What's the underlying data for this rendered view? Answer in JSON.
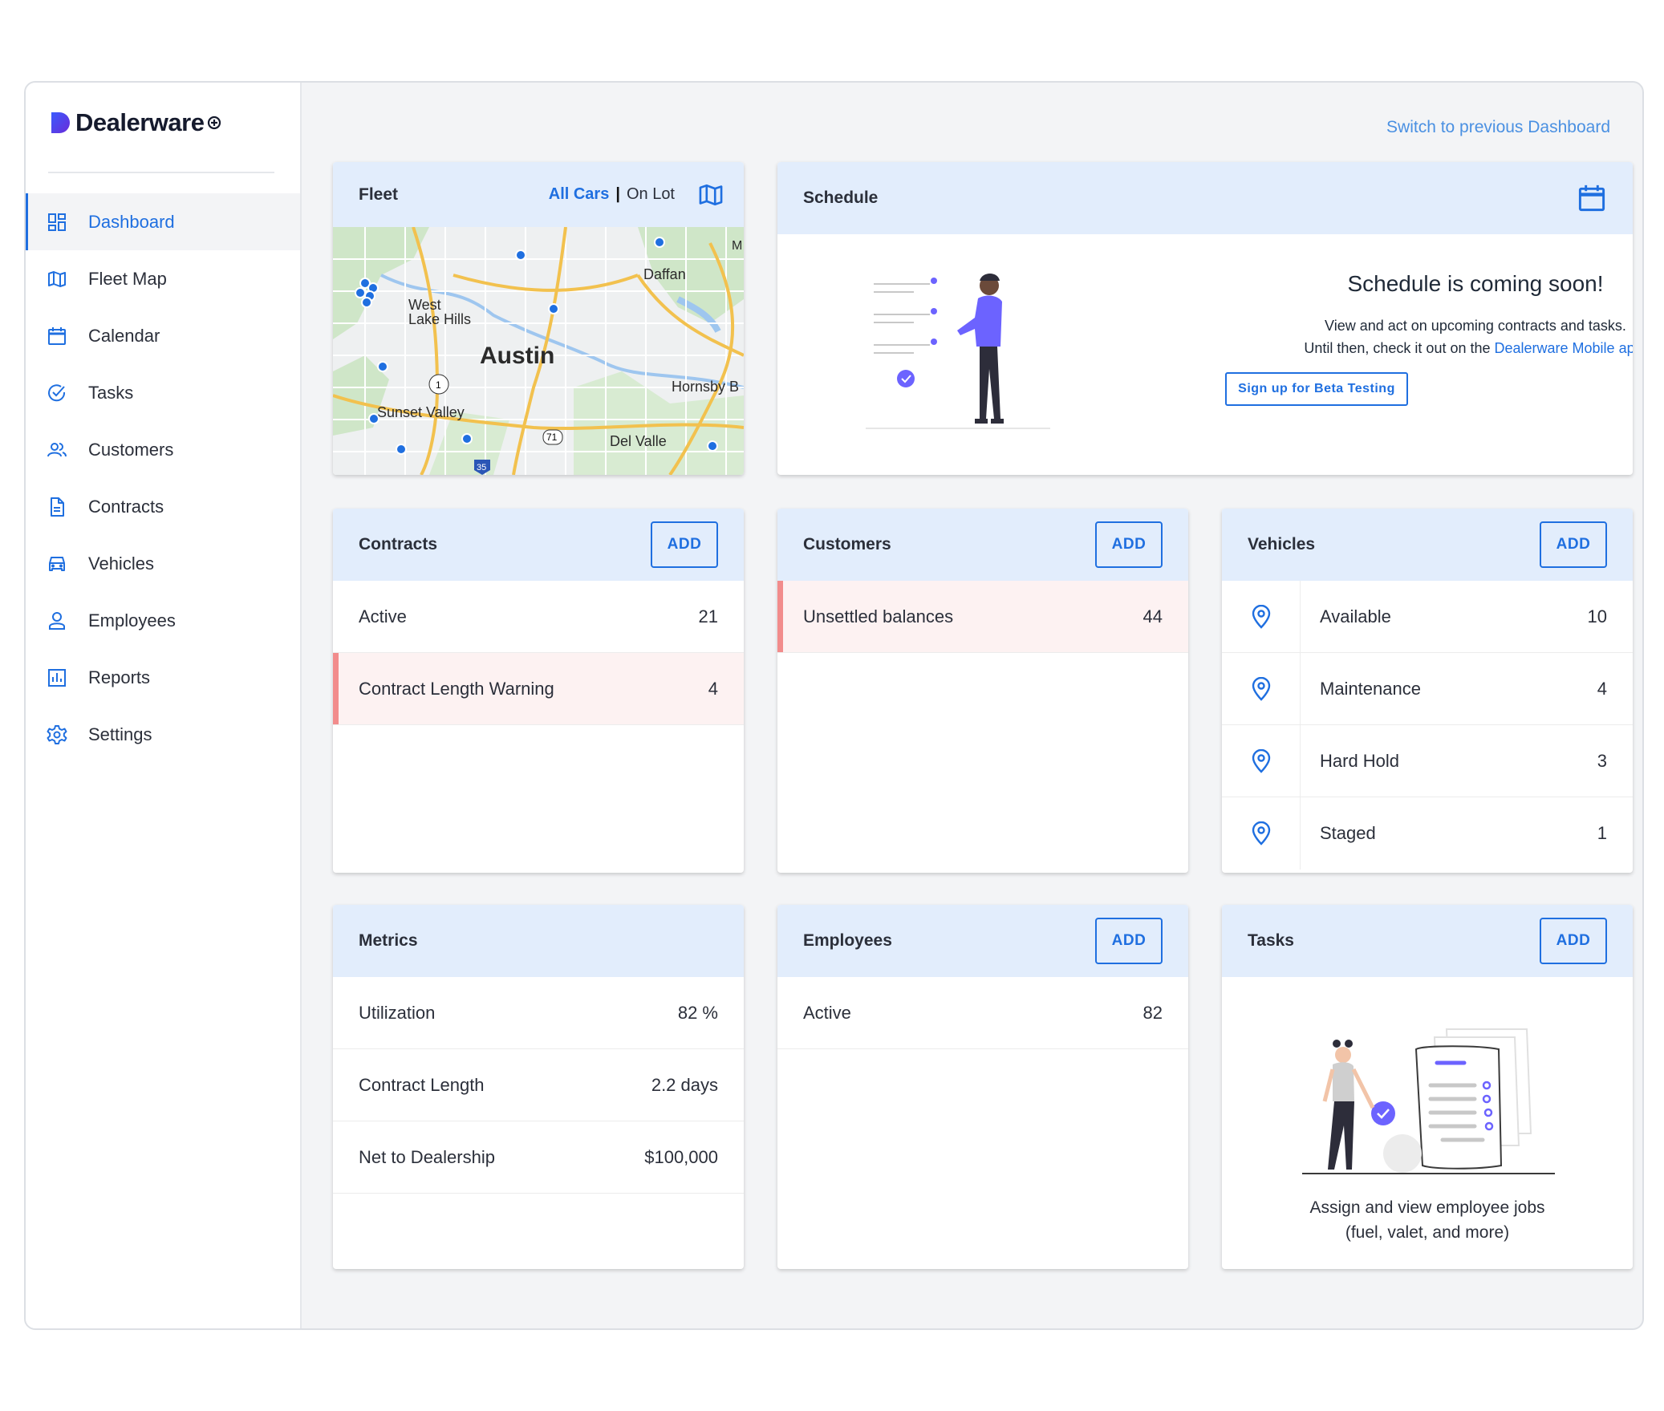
{
  "brand": {
    "name": "Dealerware",
    "accent": "#1f6fe0"
  },
  "sidebar": {
    "items": [
      {
        "label": "Dashboard",
        "icon": "dashboard-icon",
        "active": true
      },
      {
        "label": "Fleet Map",
        "icon": "map-icon"
      },
      {
        "label": "Calendar",
        "icon": "calendar-icon"
      },
      {
        "label": "Tasks",
        "icon": "check-circle-icon"
      },
      {
        "label": "Customers",
        "icon": "users-icon"
      },
      {
        "label": "Contracts",
        "icon": "document-icon"
      },
      {
        "label": "Vehicles",
        "icon": "car-icon"
      },
      {
        "label": "Employees",
        "icon": "user-icon"
      },
      {
        "label": "Reports",
        "icon": "bar-chart-icon"
      },
      {
        "label": "Settings",
        "icon": "gear-icon"
      }
    ]
  },
  "switch_link": "Switch to previous Dashboard",
  "fleet": {
    "title": "Fleet",
    "all_cars": "All Cars",
    "separator": "|",
    "on_lot": "On Lot",
    "map_labels": [
      "Austin",
      "West Lake Hills",
      "Daffan",
      "Hornsby B",
      "Sunset Valley",
      "Del Valle",
      "M",
      "1",
      "71",
      "35"
    ]
  },
  "schedule": {
    "title": "Schedule",
    "heading": "Schedule is coming soon!",
    "line1": "View and act on upcoming contracts and tasks.",
    "line2_prefix": "Until then, check it out on the ",
    "line2_link": "Dealerware Mobile app",
    "line2_suffix": ".",
    "beta_button": "Sign up for Beta Testing"
  },
  "contracts": {
    "title": "Contracts",
    "add": "ADD",
    "rows": [
      {
        "label": "Active",
        "value": "21",
        "warn": false
      },
      {
        "label": "Contract Length Warning",
        "value": "4",
        "warn": true
      }
    ]
  },
  "customers": {
    "title": "Customers",
    "add": "ADD",
    "rows": [
      {
        "label": "Unsettled balances",
        "value": "44",
        "warn": true
      }
    ]
  },
  "vehicles": {
    "title": "Vehicles",
    "add": "ADD",
    "rows": [
      {
        "label": "Available",
        "value": "10"
      },
      {
        "label": "Maintenance",
        "value": "4"
      },
      {
        "label": "Hard Hold",
        "value": "3"
      },
      {
        "label": "Staged",
        "value": "1"
      }
    ]
  },
  "metrics": {
    "title": "Metrics",
    "rows": [
      {
        "label": "Utilization",
        "value": "82 %"
      },
      {
        "label": "Contract Length",
        "value": "2.2 days"
      },
      {
        "label": "Net to Dealership",
        "value": "$100,000"
      }
    ]
  },
  "employees": {
    "title": "Employees",
    "add": "ADD",
    "rows": [
      {
        "label": "Active",
        "value": "82"
      }
    ]
  },
  "tasks": {
    "title": "Tasks",
    "add": "ADD",
    "line1": "Assign and view employee jobs",
    "line2": "(fuel, valet, and more)"
  }
}
